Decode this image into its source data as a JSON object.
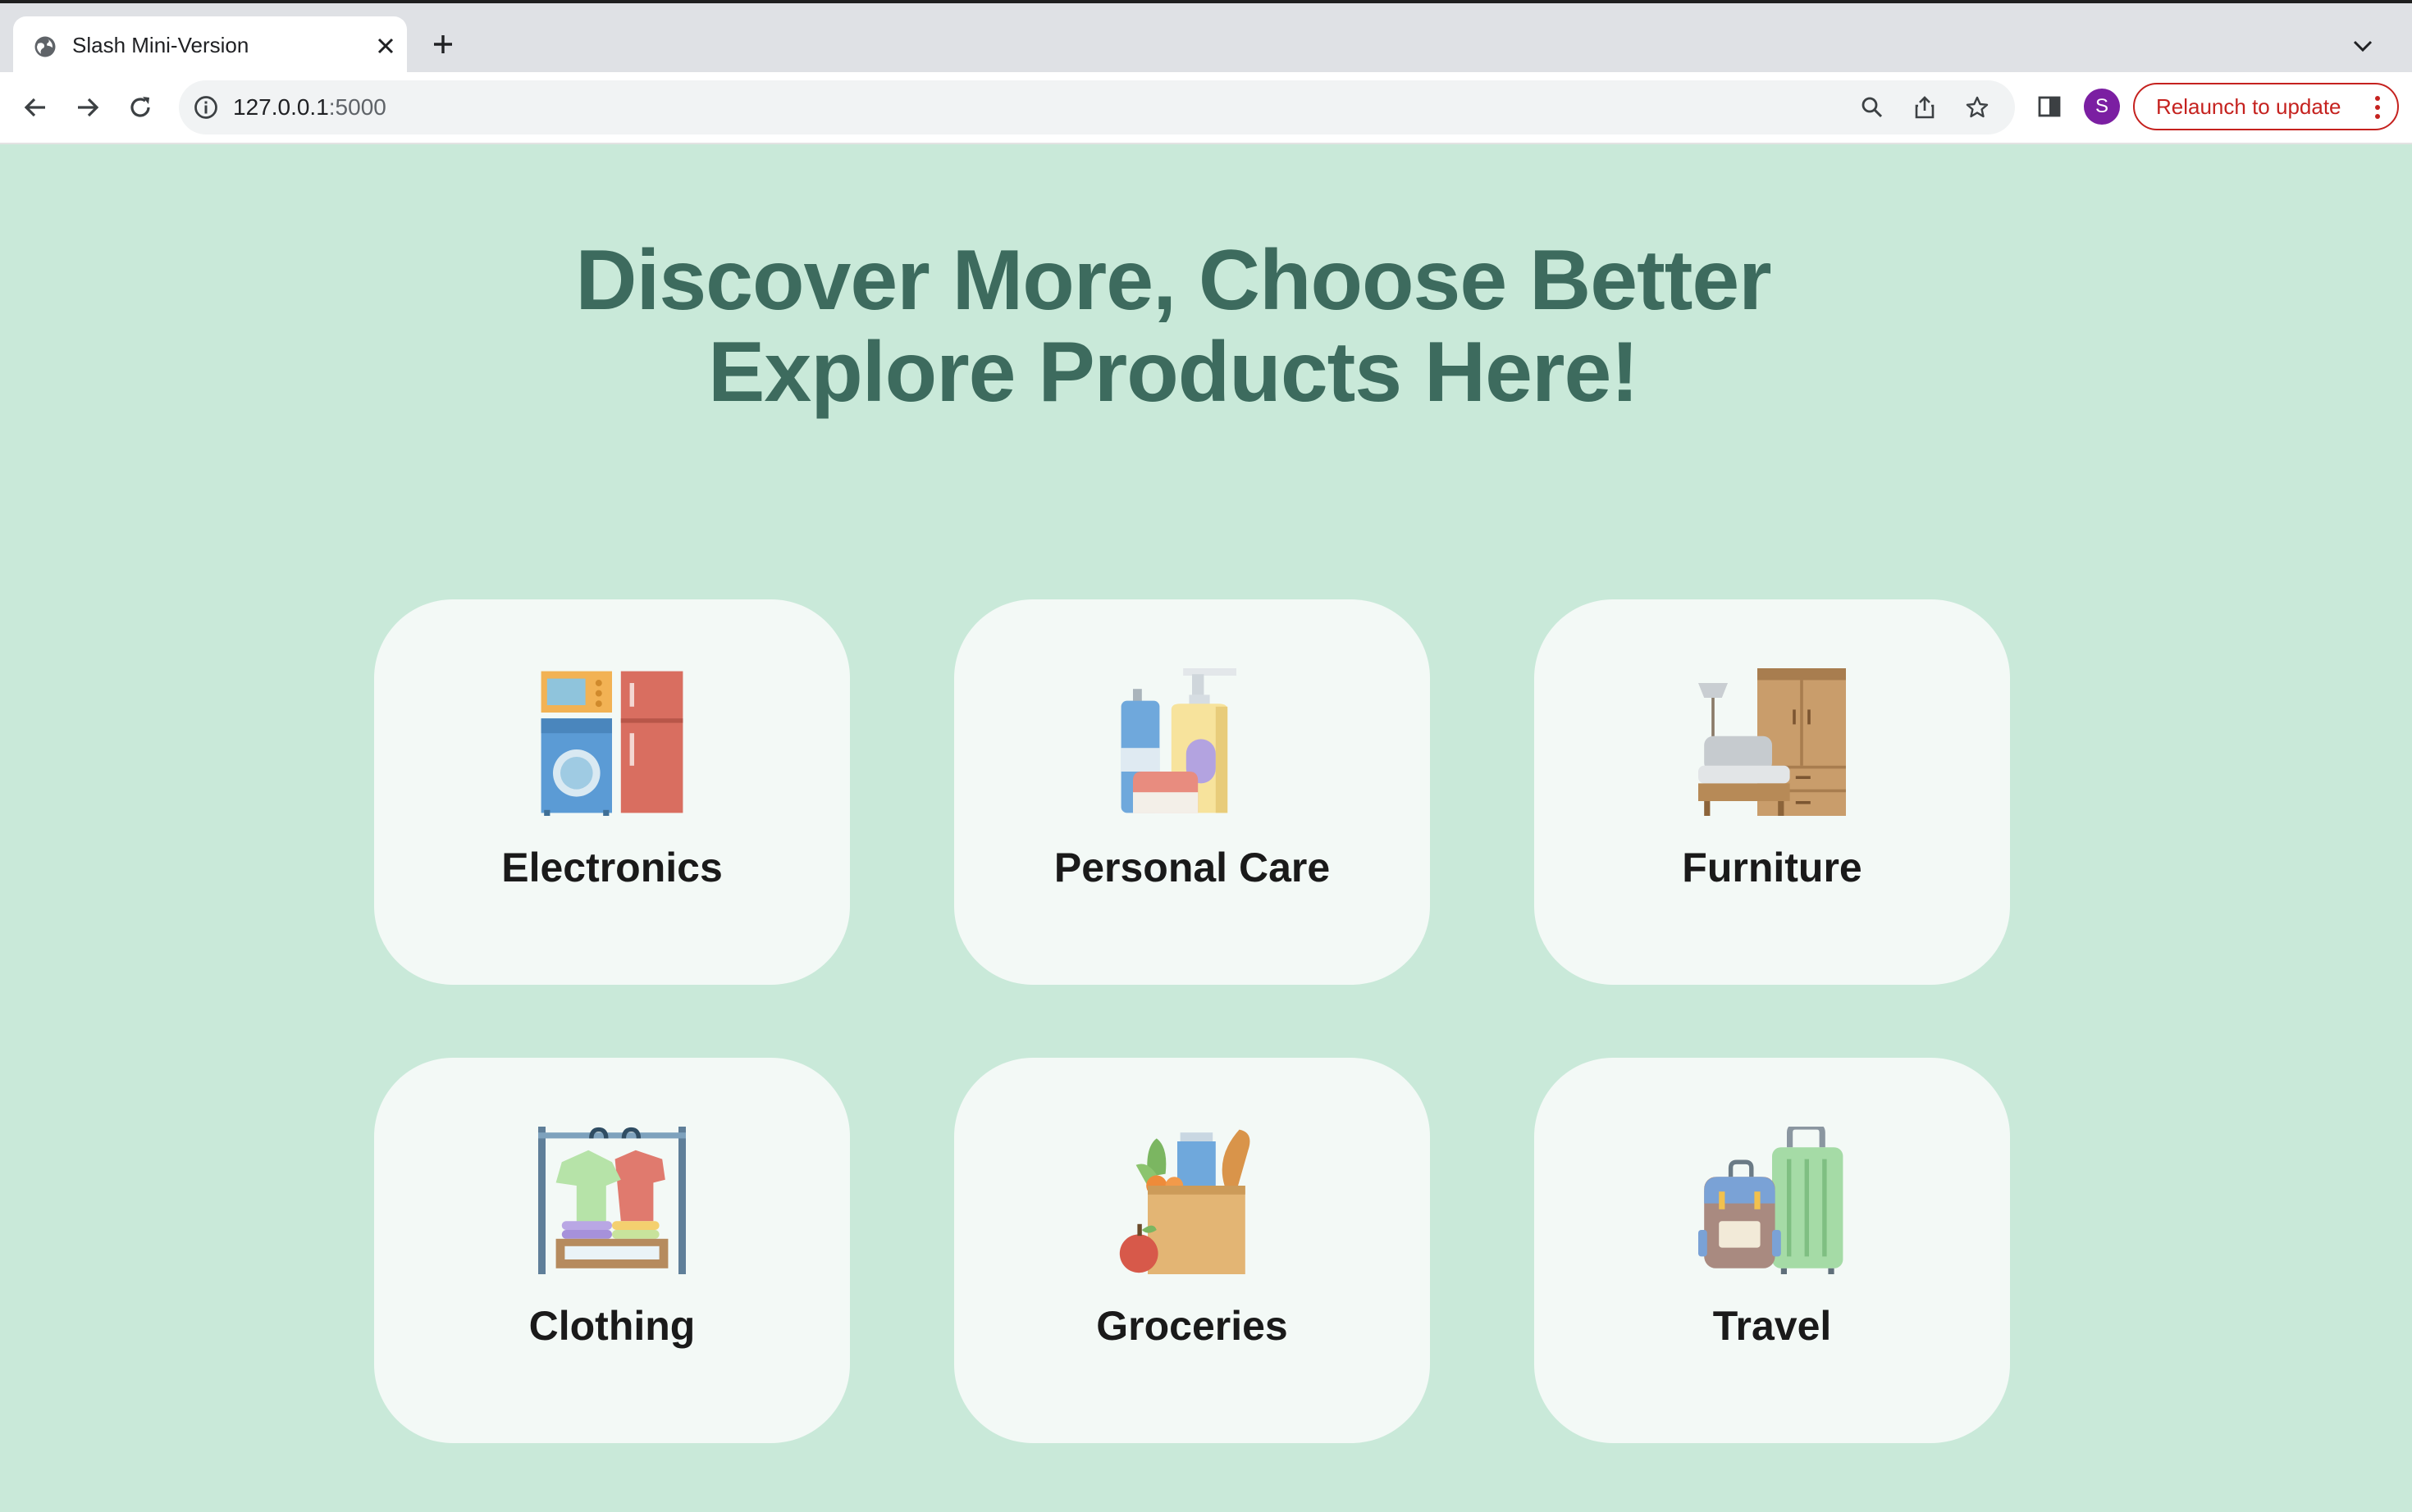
{
  "browser": {
    "tab_title": "Slash Mini-Version",
    "url_host": "127.0.0.1",
    "url_port": ":5000",
    "profile_initial": "S",
    "relaunch_label": "Relaunch to update"
  },
  "page": {
    "headline_line1": "Discover More, Choose Better",
    "headline_line2": "Explore Products Here!"
  },
  "categories": [
    {
      "label": "Electronics"
    },
    {
      "label": "Personal Care"
    },
    {
      "label": "Furniture"
    },
    {
      "label": "Clothing"
    },
    {
      "label": "Groceries"
    },
    {
      "label": "Travel"
    }
  ],
  "colors": {
    "page_background": "#c9e9d9",
    "headline": "#3d6b5e",
    "card_background": "#f3f9f6",
    "relaunch_accent": "#c5221f",
    "avatar": "#7b1fa2"
  }
}
